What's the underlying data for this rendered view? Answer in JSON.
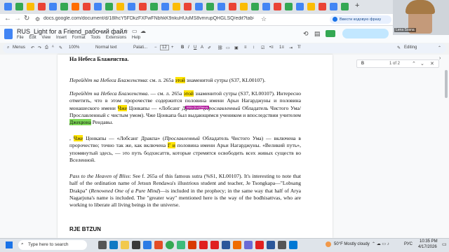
{
  "browser": {
    "url": "docs.google.com/document/d/18lhcY5FDkzFXFwFNbhkK9nkuHUuMS8vmrupQHGLSQ/edit?tab=t.0",
    "extension_label": "Ввести кодовую фразу"
  },
  "docs": {
    "title": "RUS_Light for a Friend_рабочий файл",
    "menu": [
      "File",
      "Edit",
      "View",
      "Insert",
      "Format",
      "Tools",
      "Extensions",
      "Help"
    ],
    "toolbar": {
      "menus": "Menus",
      "zoom": "100%",
      "style": "Normal text",
      "font": "Palati...",
      "size": "12",
      "mode": "Editing"
    },
    "find": {
      "query": "B",
      "count": "1 of 2"
    }
  },
  "content": {
    "heading_top": "На Небеса Блаженства.",
    "p1_a": "Перейдёт на Небеса Блаженства",
    "p1_b": ": см. л. 265а ",
    "p1_hl": "этой",
    "p1_c": " знаменитой сутры (S37, KL00107).",
    "p2_a": "Перейдёт на Небеса Блаженства",
    "p2_b": ". — см. л. 265а ",
    "p2_hl": "этой",
    "p2_c": " знаменитой сутры (S37, KL00107). Интересно отметить, что в этом пророчестве содержится половина имени Арьи Нагарджуны и половина монашеского имени ",
    "p2_hl2": "Чже",
    "p2_d": " Цонкапы — «Лобсанг Дракпа» (",
    "p2_e": "Прославленный",
    "p2_f": " Обладатель Чистого Ума/ Прославленный с чистым умом). Чже Цонкапа был выдающимся учеником и впоследствии учителем ",
    "p2_hl3": "Джецюна",
    "p2_g": " Ренд­авы.",
    "comment_chip": "Mira Dorzhieva",
    "p3_a": ", ",
    "p3_hl": "Чже",
    "p3_b": " Цонкапы — «Лобсанг Дракпа» (",
    "p3_c": "Прославленный",
    "p3_d": " Обладатель Чистого Ума) — включена в пророчество; точно так же, как включена ",
    "p3_hl2": "Г и",
    "p3_e": " половина имени Арьи Нагарджуны. «Великий путь», упомянутый здесь, — это путь бодхисаттв, которые стремятся освободить всех живых существ во Вселенной.",
    "p4_a": "Pass to the Heaven of Bliss",
    "p4_b": ": See f. 265a of this famous sutra (%S1, KL00107). It's interesting to note that half of the ordination name of Jetsun Rendawa's illustrious student and teacher, Je Tsongkapa—\"Lobsang Drakpa\" (",
    "p4_c": "Renowned One of a Pure Mind",
    "p4_d": ")—is included in the prophecy; in the same way that half of Arya Nagarjuna's name is included. The \"greater way\" mentioned here is the way of the bodhisattvas, who are working to liberate all living beings in the universe.",
    "p5": "RJE BTZUN"
  },
  "webcam": {
    "name": "Lena Sosna"
  },
  "taskbar": {
    "search_placeholder": "Type here to search",
    "weather": "50°F  Mostly cloudy",
    "lang": "РУС",
    "time": "10:35 PM",
    "date": "4/17/2026"
  },
  "colors": {
    "highlight": "#ffe300",
    "green_highlight": "#7ed957",
    "accent": "#1a73e8"
  }
}
